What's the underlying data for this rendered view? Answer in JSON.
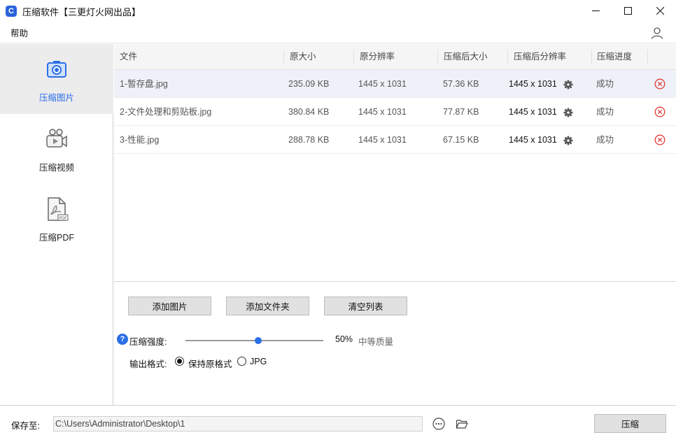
{
  "window": {
    "app_icon_glyph": "C",
    "title": "压缩软件【三更灯火网出品】"
  },
  "menu": {
    "help": "帮助"
  },
  "sidebar": {
    "items": [
      {
        "label": "压缩图片",
        "icon": "camera-icon",
        "active": true
      },
      {
        "label": "压缩视频",
        "icon": "video-camera-icon",
        "active": false
      },
      {
        "label": "压缩PDF",
        "icon": "pdf-file-icon",
        "active": false
      }
    ]
  },
  "table": {
    "headers": [
      "文件",
      "原大小",
      "原分辨率",
      "压缩后大小",
      "压缩后分辨率",
      "压缩进度"
    ],
    "rows": [
      {
        "file": "1-暂存盘.jpg",
        "orig_size": "235.09 KB",
        "orig_res": "1445 x 1031",
        "new_size": "57.36 KB",
        "new_res": "1445 x 1031",
        "status": "成功"
      },
      {
        "file": "2-文件处理和剪贴板.jpg",
        "orig_size": "380.84 KB",
        "orig_res": "1445 x 1031",
        "new_size": "77.87 KB",
        "new_res": "1445 x 1031",
        "status": "成功"
      },
      {
        "file": "3-性能.jpg",
        "orig_size": "288.78 KB",
        "orig_res": "1445 x 1031",
        "new_size": "67.15 KB",
        "new_res": "1445 x 1031",
        "status": "成功"
      }
    ]
  },
  "controls": {
    "add_image": "添加图片",
    "add_folder": "添加文件夹",
    "clear_list": "清空列表",
    "help_glyph": "?",
    "strength_label": "压缩强度:",
    "strength_value": "50%",
    "strength_fraction": 0.5,
    "quality_label": "中等质量",
    "format_label": "输出格式:",
    "format_options": [
      "保持原格式",
      "JPG"
    ],
    "format_selected": "保持原格式"
  },
  "bottom": {
    "save_to_label": "保存至:",
    "save_path": "C:\\Users\\Administrator\\Desktop\\1",
    "compress_button": "压缩"
  },
  "colors": {
    "accent": "#2a6ee8",
    "delete_red": "#e03a3a"
  }
}
